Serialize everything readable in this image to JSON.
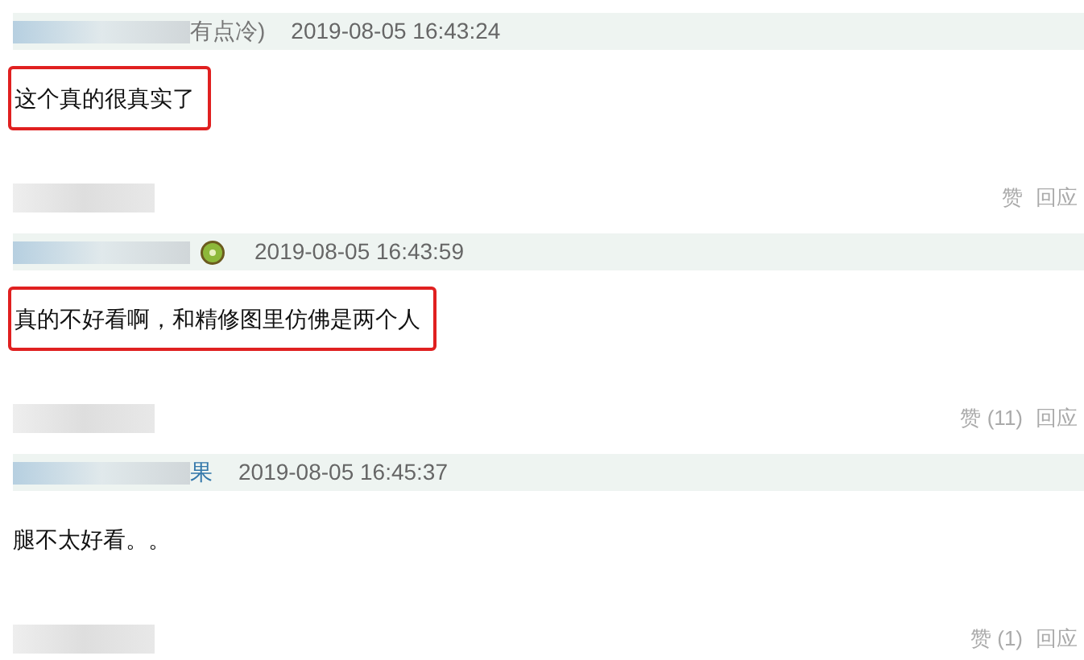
{
  "comments": [
    {
      "username_tail": "有点冷)",
      "has_badge": false,
      "time": "2019-08-05 16:43:24",
      "text": "这个真的很真实了",
      "highlighted": true,
      "like": "赞",
      "reply": "回应"
    },
    {
      "has_badge": true,
      "time": "2019-08-05 16:43:59",
      "text": "真的不好看啊，和精修图里仿佛是两个人",
      "highlighted": true,
      "like": "赞 (11)",
      "reply": "回应"
    },
    {
      "username_tail": "果",
      "has_badge": false,
      "time": "2019-08-05 16:45:37",
      "text": "腿不太好看。。",
      "highlighted": false,
      "like": "赞 (1)",
      "reply": "回应"
    }
  ]
}
